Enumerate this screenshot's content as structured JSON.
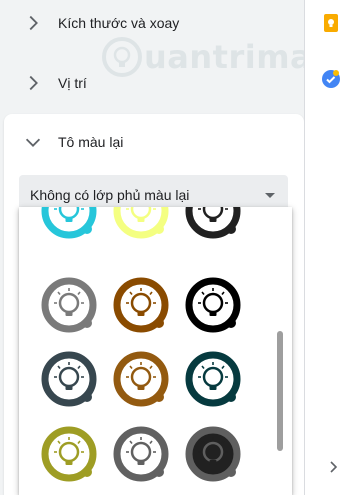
{
  "sections": {
    "size_rotation": "Kích thước và xoay",
    "position": "Vị trí",
    "recolor": "Tô màu lại"
  },
  "recolor_dropdown": {
    "value": "Không có lớp phủ màu lại"
  },
  "swatches": [
    {
      "ring": "#26c6da",
      "bg": "#ffffff",
      "bulb": "#26c6da"
    },
    {
      "ring": "#f4ff81",
      "bg": "#ffffff",
      "bulb": "#f4ff81"
    },
    {
      "ring": "#212121",
      "bg": "#ffffff",
      "bulb": "#212121"
    },
    {
      "ring": "#7a7a7a",
      "bg": "#ffffff",
      "bulb": "#7a7a7a"
    },
    {
      "ring": "#8a4b00",
      "bg": "#ffffff",
      "bulb": "#8a4b00"
    },
    {
      "ring": "#000000",
      "bg": "#ffffff",
      "bulb": "#000000"
    },
    {
      "ring": "#37474f",
      "bg": "#ffffff",
      "bulb": "#37474f"
    },
    {
      "ring": "#935a10",
      "bg": "#ffffff",
      "bulb": "#935a10"
    },
    {
      "ring": "#063a3f",
      "bg": "#ffffff",
      "bulb": "#063a3f"
    },
    {
      "ring": "#9e9d24",
      "bg": "#ffffff",
      "bulb": "#9e9d24"
    },
    {
      "ring": "#616161",
      "bg": "#ffffff",
      "bulb": "#616161"
    },
    {
      "ring": "#5f5f5f",
      "bg": "#212121",
      "bulb": "#212121"
    }
  ],
  "watermark": "uantrimang",
  "colors": {
    "keep_icon": "#f9ab00",
    "tasks_icon": "#4285f4"
  }
}
